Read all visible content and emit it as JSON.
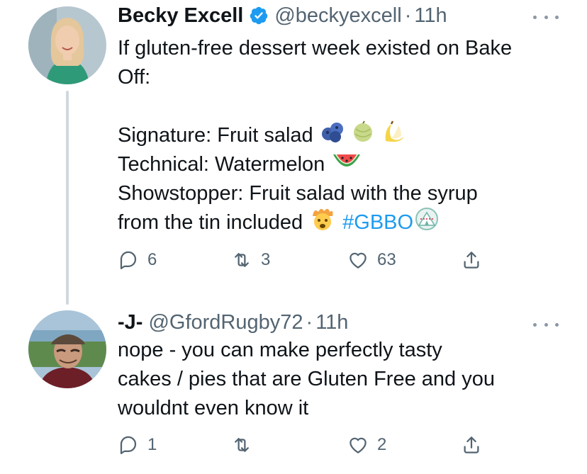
{
  "tweets": [
    {
      "name": "Becky Excell",
      "handle": "@beckyexcell",
      "separator": "·",
      "time": "11h",
      "lines": [
        "If gluten-free dessert week existed on Bake",
        "Off:",
        "",
        "Signature: Fruit salad",
        "Technical: Watermelon",
        "Showstopper: Fruit salad with the syrup",
        "from the tin included"
      ],
      "hashtag": "#GBBO",
      "reply_count": "6",
      "retweet_count": "3",
      "like_count": "63"
    },
    {
      "name": "-J-",
      "handle": "@GfordRugby72",
      "separator": "·",
      "time": "11h",
      "lines": [
        "nope - you can make perfectly tasty",
        "cakes / pies that are Gluten Free and you",
        "wouldnt even know it"
      ],
      "reply_count": "1",
      "retweet_count": "",
      "like_count": "2"
    }
  ],
  "icons": {
    "verified": "verified-badge-icon",
    "more": "more-icon",
    "reply": "reply-icon",
    "retweet": "retweet-icon",
    "like": "heart-icon",
    "share": "share-icon",
    "emoji_signature": [
      "blueberries-emoji",
      "melon-emoji",
      "banana-emoji"
    ],
    "emoji_technical": "watermelon-emoji",
    "emoji_showstopper": "exploding-head-emoji",
    "emoji_hashtag": "tent-emoji"
  },
  "colors": {
    "text": "#0f1419",
    "secondary": "#536471",
    "link": "#1d9bf0",
    "verified": "#1d9bf0",
    "thread_line": "#cfd9de"
  }
}
